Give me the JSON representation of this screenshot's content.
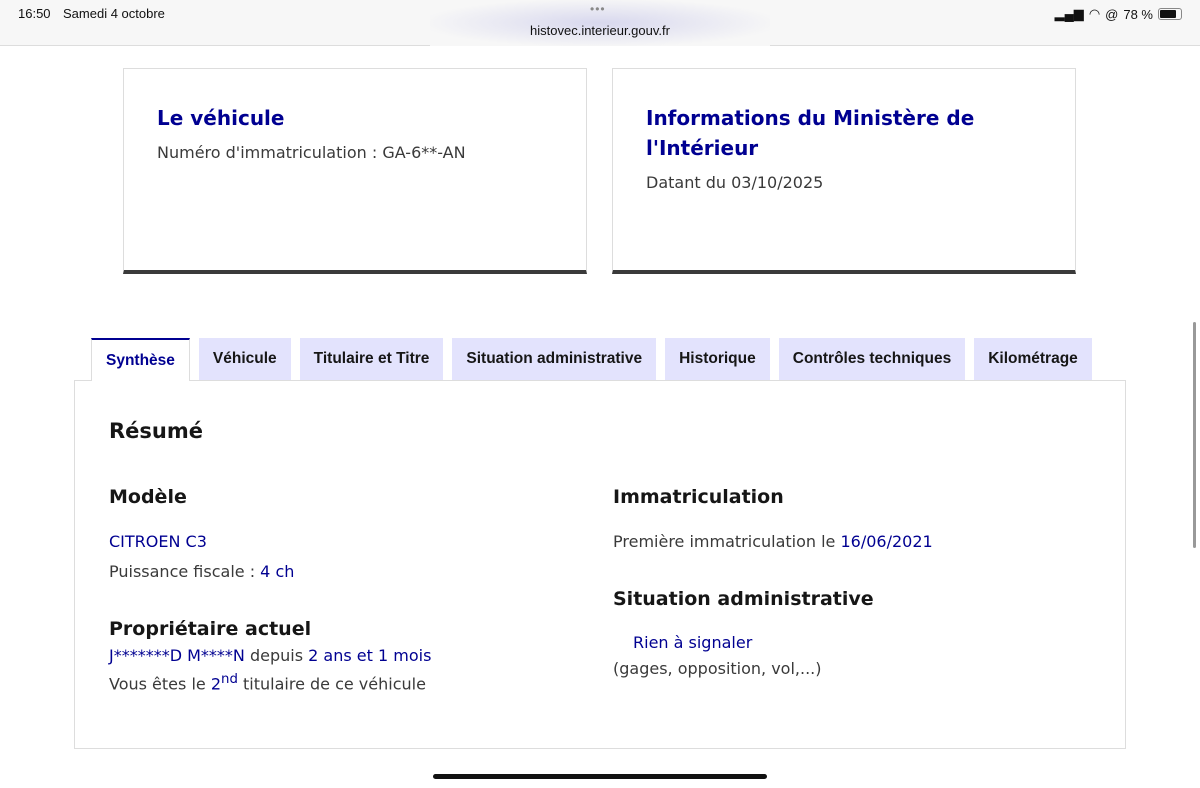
{
  "status_bar": {
    "time": "16:50",
    "date": "Samedi 4 octobre",
    "url": "histovec.interieur.gouv.fr",
    "battery": "78 %",
    "battery_level": 78
  },
  "cards": [
    {
      "title": "Le véhicule",
      "text": "Numéro d'immatriculation : GA-6**-AN"
    },
    {
      "title": "Informations du Ministère de l'Intérieur",
      "text": "Datant du 03/10/2025"
    }
  ],
  "tabs": [
    "Synthèse",
    "Véhicule",
    "Titulaire et Titre",
    "Situation administrative",
    "Historique",
    "Contrôles techniques",
    "Kilométrage"
  ],
  "summary": {
    "title": "Résumé",
    "model_heading": "Modèle",
    "model": "CITROEN C3",
    "power_label": "Puissance fiscale : ",
    "power": "4 ch",
    "owner_heading": "Propriétaire actuel",
    "owner": "J*******D M****N",
    "since_label": " depuis ",
    "since": "2 ans et 1 mois",
    "rank_prefix": "Vous êtes le ",
    "rank": "2",
    "rank_sup": "nd",
    "rank_suffix": " titulaire de ce véhicule",
    "immat_heading": "Immatriculation",
    "immat_label": "Première immatriculation le ",
    "immat_date": "16/06/2021",
    "admin_heading": "Situation administrative",
    "admin_status": "Rien à signaler",
    "admin_note": "(gages, opposition, vol,...)"
  }
}
